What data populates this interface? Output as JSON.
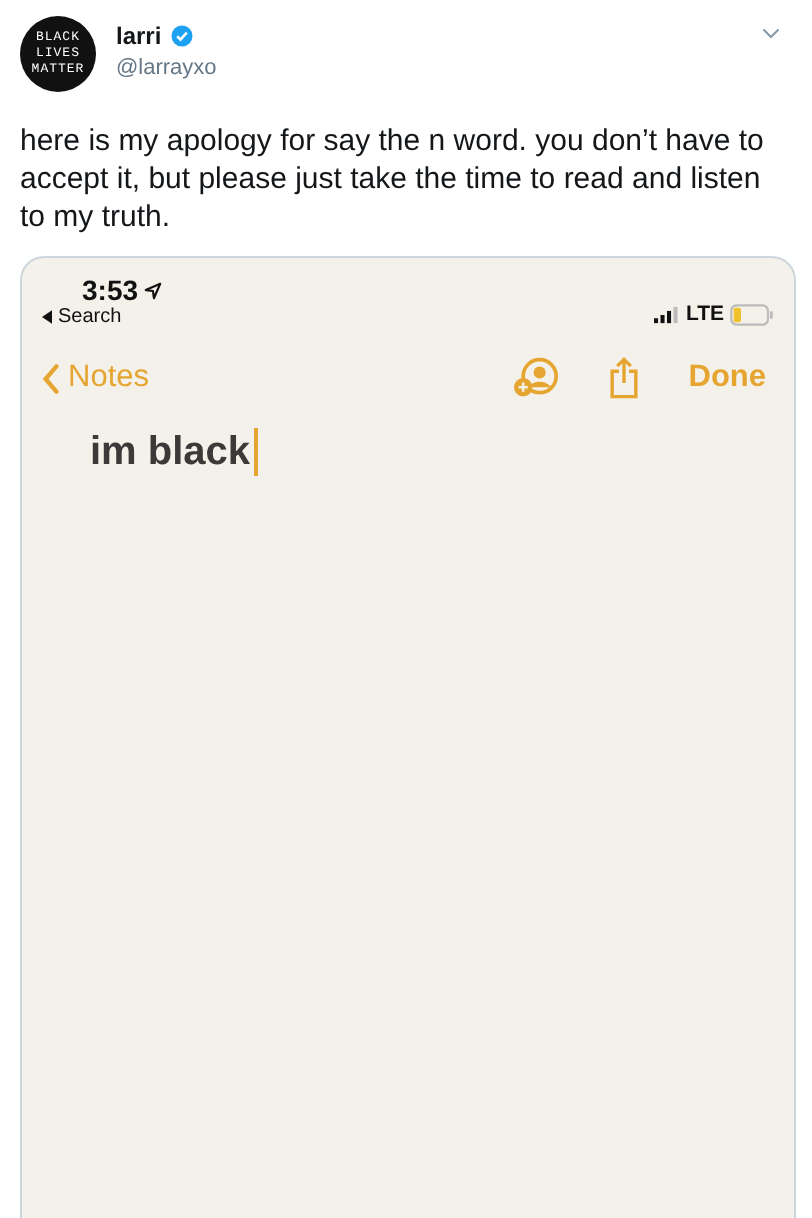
{
  "author": {
    "avatar_lines": [
      "BLACK",
      "LIVES",
      "MATTER"
    ],
    "name": "larri",
    "verified": true,
    "handle": "@larrayxo"
  },
  "tweet_text": "here is my apology for say the n word. you don’t have to accept it, but please just take the time to read and listen to my truth.",
  "phone": {
    "status_bar": {
      "time": "3:53",
      "back_label": "Search",
      "network": "LTE"
    },
    "nav": {
      "back_label": "Notes",
      "done_label": "Done"
    },
    "note": {
      "text": "im black",
      "cursor": true
    }
  }
}
